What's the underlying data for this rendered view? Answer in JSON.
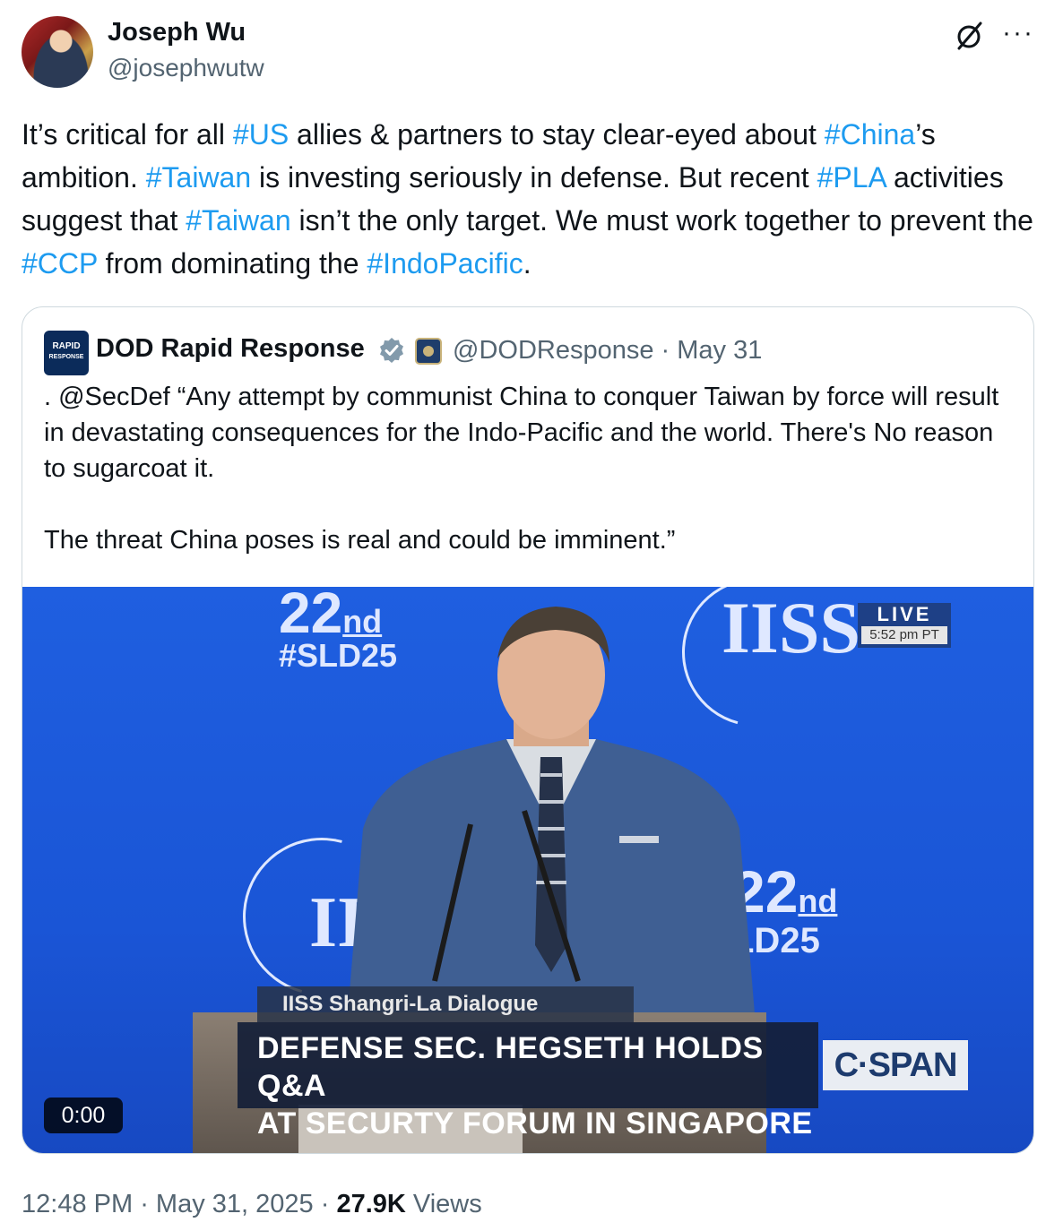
{
  "author": {
    "name": "Joseph Wu",
    "handle": "@josephwutw",
    "avatar_icon": "profile-photo"
  },
  "header_icons": {
    "grok": "grok-icon",
    "more": "more-icon",
    "more_label": "···"
  },
  "tweet": {
    "segments": [
      {
        "text": "It’s critical for all ",
        "hashtag": false
      },
      {
        "text": "#US",
        "hashtag": true
      },
      {
        "text": " allies & partners to stay clear-eyed about ",
        "hashtag": false
      },
      {
        "text": "#China",
        "hashtag": true
      },
      {
        "text": "’s ambition. ",
        "hashtag": false
      },
      {
        "text": "#Taiwan",
        "hashtag": true
      },
      {
        "text": " is investing seriously in defense. But recent ",
        "hashtag": false
      },
      {
        "text": "#PLA",
        "hashtag": true
      },
      {
        "text": " activities suggest that ",
        "hashtag": false
      },
      {
        "text": "#Taiwan",
        "hashtag": true
      },
      {
        "text": " isn’t the only target. We must work together to prevent the ",
        "hashtag": false
      },
      {
        "text": "#CCP",
        "hashtag": true
      },
      {
        "text": " from dominating the ",
        "hashtag": false
      },
      {
        "text": "#IndoPacific",
        "hashtag": true
      },
      {
        "text": ".",
        "hashtag": false
      }
    ]
  },
  "quote": {
    "logo_line1": "RAPID",
    "logo_line2": "RESPONSE",
    "name": "DOD Rapid Response",
    "handle": "@DODResponse",
    "separator": " · ",
    "date": "May 31",
    "text_p1": ". @SecDef “Any attempt by communist China to conquer Taiwan by force will result in devastating consequences for the Indo-Pacific and the world. There's No reason to sugarcoat it.",
    "text_p2": "The threat China poses is real and could be imminent.”",
    "video": {
      "sld_number": "22",
      "sld_suffix": "nd",
      "sld_tag": "#SLD25",
      "sld_tag_mid": "LD25",
      "iiss": "IISS",
      "iiss_partial": "II",
      "live_label": "LIVE",
      "live_time": "5:52 pm PT",
      "lectern_label": "IISS Shangri-La Dialogue",
      "headline_line1": "DEFENSE SEC. HEGSETH HOLDS Q&A",
      "headline_line2": "AT SECURTY FORUM IN SINGAPORE",
      "network": "C·SPAN",
      "timecode": "0:00"
    }
  },
  "footer": {
    "time": "12:48 PM",
    "sep": " · ",
    "date": "May 31, 2025",
    "views_count": "27.9K",
    "views_label": " Views"
  },
  "colors": {
    "link": "#1d9bf0",
    "secondary_text": "#536471",
    "video_bg": "#1f5fe0"
  }
}
